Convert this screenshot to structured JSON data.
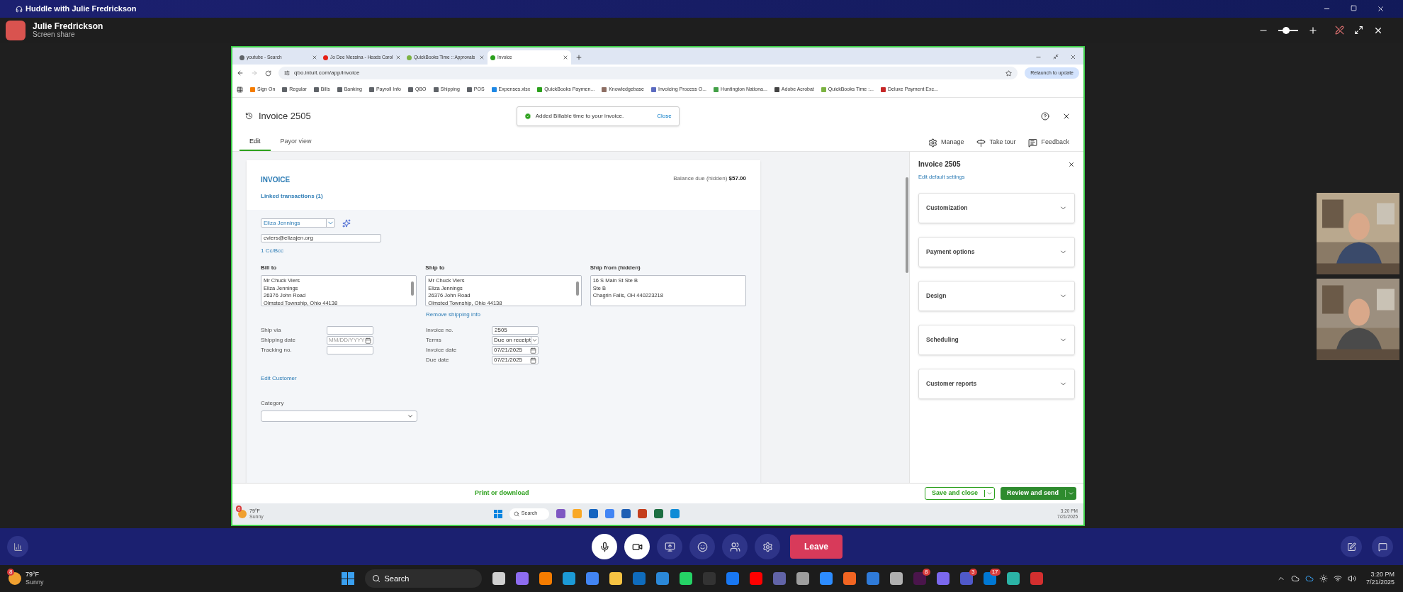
{
  "huddle_title": "Huddle with Julie Fredrickson",
  "presenter": {
    "name": "Julie Fredrickson",
    "subtitle": "Screen share"
  },
  "zoom_slider": {
    "level": 0.4
  },
  "browser": {
    "tabs": [
      {
        "label": "youtube - Search",
        "selected": false,
        "color": "#5f6368"
      },
      {
        "label": "Jo Dee Messina - Heads Carol",
        "selected": false,
        "color": "#e62117"
      },
      {
        "label": "QuickBooks Time :: Approvals",
        "selected": false,
        "color": "#7cb342"
      },
      {
        "label": "Invoice",
        "selected": true,
        "color": "#2ca01c"
      }
    ],
    "address": "qbo.intuit.com/app/invoice",
    "relaunch": "Relaunch to update",
    "bookmarks": [
      {
        "label": "Sign On",
        "color": "#f57c00"
      },
      {
        "label": "Regular",
        "color": "#5f6368"
      },
      {
        "label": "Bills",
        "color": "#5f6368"
      },
      {
        "label": "Banking",
        "color": "#5f6368"
      },
      {
        "label": "Payroll Info",
        "color": "#5f6368"
      },
      {
        "label": "QBO",
        "color": "#5f6368"
      },
      {
        "label": "Shipping",
        "color": "#5f6368"
      },
      {
        "label": "POS",
        "color": "#5f6368"
      },
      {
        "label": "Expenses.xlsx",
        "color": "#1e88e5"
      },
      {
        "label": "QuickBooks Paymen...",
        "color": "#2ca01c"
      },
      {
        "label": "Knowledgebase",
        "color": "#8d6e63"
      },
      {
        "label": "Invoicing Process O...",
        "color": "#5c6bc0"
      },
      {
        "label": "Huntington Nationa...",
        "color": "#43a047"
      },
      {
        "label": "Adobe Acrobat",
        "color": "#424242"
      },
      {
        "label": "QuickBooks Time :...",
        "color": "#7cb342"
      },
      {
        "label": "Deluxe Payment Exc...",
        "color": "#c62828"
      }
    ]
  },
  "invoice_header": {
    "title": "Invoice 2505",
    "toast": {
      "message": "Added Billable time to your invoice.",
      "action": "Close"
    }
  },
  "view_tabs": [
    {
      "label": "Edit",
      "selected": true
    },
    {
      "label": "Payor view",
      "selected": false
    }
  ],
  "toolbar": [
    {
      "kind": "manage",
      "label": "Manage"
    },
    {
      "kind": "tour",
      "label": "Take tour"
    },
    {
      "kind": "feedback",
      "label": "Feedback"
    }
  ],
  "form": {
    "heading": "INVOICE",
    "linked": "Linked transactions (1)",
    "balance_label": "Balance due (hidden)",
    "balance": "$57.00",
    "customer": "Eliza Jennings",
    "email": "cviers@elizajen.org",
    "cc": "1 Cc/Bcc",
    "addresses": [
      {
        "label": "Bill to",
        "lines": [
          "Mr Chuck Viers",
          "Eliza Jennings",
          "26376 John Road",
          "Olmsted Township, Ohio  44138"
        ],
        "scrollable": true
      },
      {
        "label": "Ship to",
        "lines": [
          "Mr Chuck Viers",
          "Eliza Jennings",
          "26376 John Road",
          "Olmsted Township, Ohio  44138"
        ],
        "scrollable": true
      },
      {
        "label": "Ship from (hidden)",
        "lines": [
          "16 S Main St Ste B",
          "Ste B",
          "Chagrin Falls, OH 440223218"
        ],
        "scrollable": false
      }
    ],
    "remove_shipping": "Remove shipping info",
    "shipping_fields": [
      {
        "kind": "text",
        "label": "Ship via"
      },
      {
        "kind": "date",
        "label": "Shipping date",
        "placeholder": "MM/DD/YYYY"
      },
      {
        "kind": "text",
        "label": "Tracking no."
      }
    ],
    "invoice_fields": [
      {
        "kind": "text",
        "label": "Invoice no.",
        "value": "2505"
      },
      {
        "kind": "select",
        "label": "Terms",
        "value": "Due on receipt"
      },
      {
        "kind": "date",
        "label": "Invoice date",
        "value": "07/21/2025"
      },
      {
        "kind": "date",
        "label": "Due date",
        "value": "07/21/2025"
      }
    ],
    "edit_customer": "Edit Customer",
    "category_label": "Category"
  },
  "panel": {
    "title": "Invoice 2505",
    "link": "Edit default settings",
    "sections": [
      {
        "label": "Customization",
        "expanded": false
      },
      {
        "label": "Payment options",
        "expanded": false
      },
      {
        "label": "Design",
        "expanded": false
      },
      {
        "label": "Scheduling",
        "expanded": false
      },
      {
        "label": "Customer reports",
        "expanded": false
      }
    ]
  },
  "footer": {
    "print": "Print or download",
    "save": "Save and close",
    "review": "Review and send"
  },
  "remote_taskbar": {
    "badge": "6",
    "temperature": "79°F",
    "weather": "Sunny",
    "search": "Search",
    "time": "3:20 PM",
    "date": "7/21/2025",
    "apps": [
      {
        "color": "#7e57c2"
      },
      {
        "color": "#f9a825"
      },
      {
        "color": "#1565c0"
      },
      {
        "color": "#4285f4"
      },
      {
        "color": "#1e5fb4"
      },
      {
        "color": "#c43e1c"
      },
      {
        "color": "#1d6f42"
      },
      {
        "color": "#0f8bd6"
      }
    ]
  },
  "call_controls": {
    "leave": "Leave"
  },
  "taskbar": {
    "badge": "8",
    "temperature": "79°F",
    "weather": "Sunny",
    "search": "Search",
    "time": "3:20 PM",
    "date": "7/21/2025",
    "apps": [
      {
        "color": "#d0d0d0"
      },
      {
        "color": "#8e6cf0"
      },
      {
        "color": "#f57c00"
      },
      {
        "color": "#1c9ad6"
      },
      {
        "color": "#4285f4"
      },
      {
        "color": "#f6c343"
      },
      {
        "color": "#0f6cbd"
      },
      {
        "color": "#2b88d8"
      },
      {
        "color": "#25d366"
      },
      {
        "color": "#333333"
      },
      {
        "color": "#1877f2"
      },
      {
        "color": "#ff0000"
      },
      {
        "color": "#6264a7"
      },
      {
        "color": "#9e9e9e"
      },
      {
        "color": "#2d8cff"
      },
      {
        "color": "#f26522"
      },
      {
        "color": "#2f7bd9"
      },
      {
        "color": "#b0b0b0"
      },
      {
        "color": "#4a154b",
        "badge": "8"
      },
      {
        "color": "#7b68ee"
      },
      {
        "color": "#5059c9",
        "badge": "3"
      },
      {
        "color": "#0078d4",
        "badge": "17"
      },
      {
        "color": "#2bb3a6"
      },
      {
        "color": "#d32f2f"
      }
    ]
  }
}
